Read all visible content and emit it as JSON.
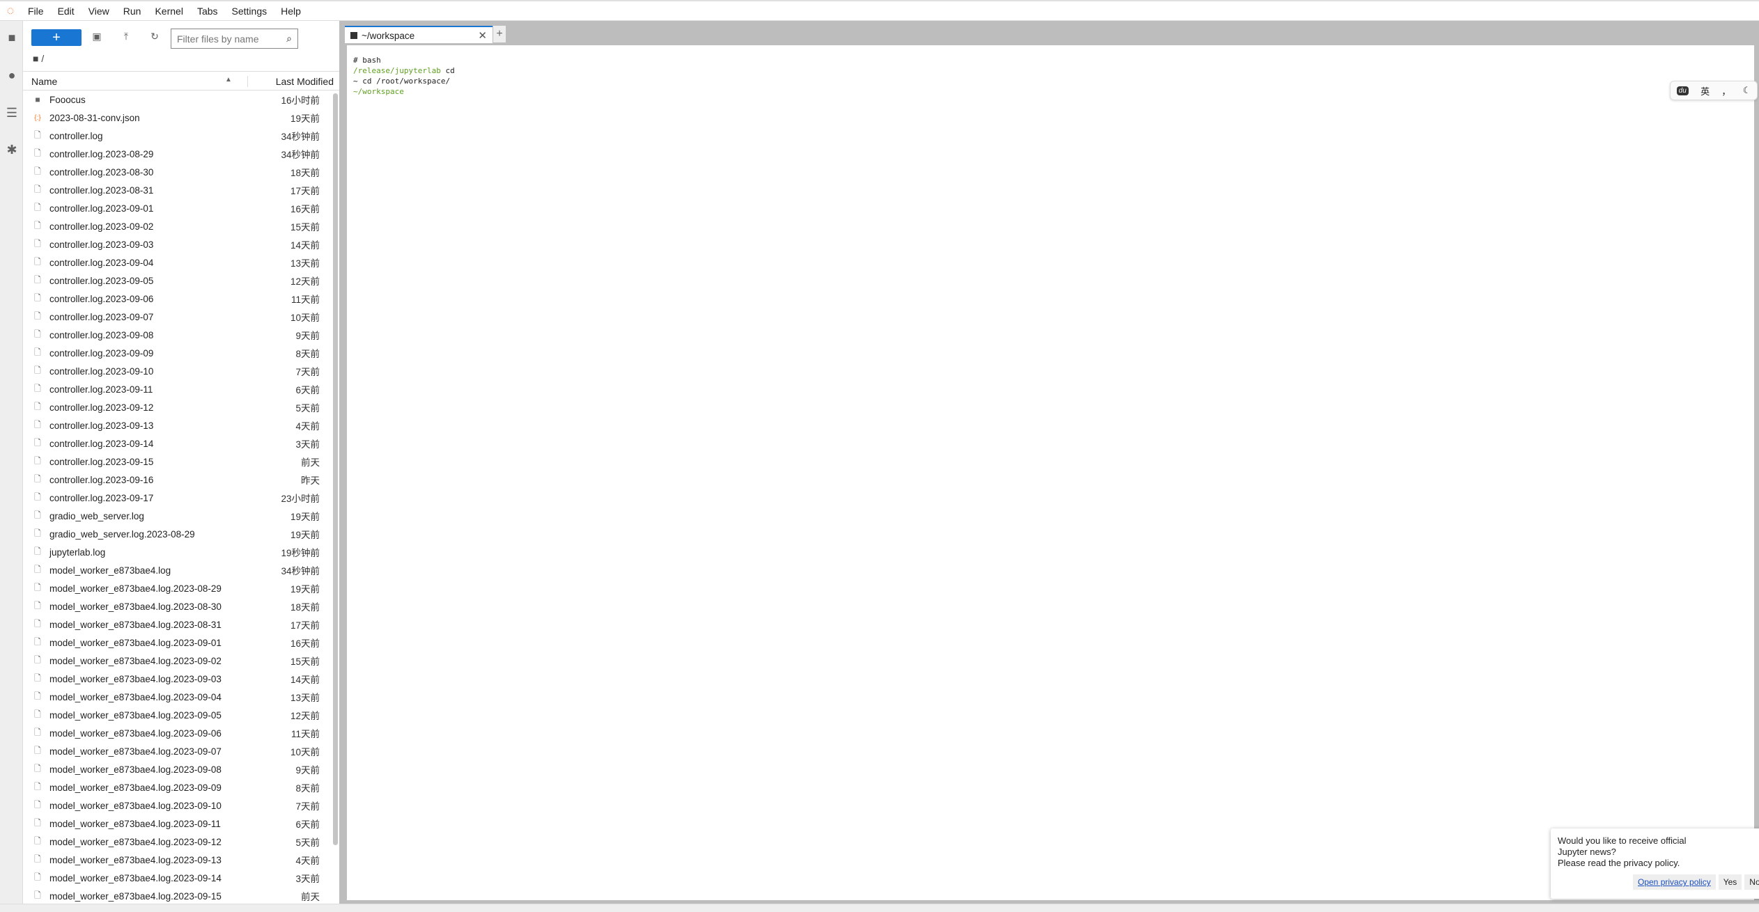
{
  "menu": [
    "File",
    "Edit",
    "View",
    "Run",
    "Kernel",
    "Tabs",
    "Settings",
    "Help"
  ],
  "filebrowser": {
    "new_label": "+",
    "filter_placeholder": "Filter files by name",
    "breadcrumb": "/",
    "col_name": "Name",
    "col_modified": "Last Modified",
    "files": [
      {
        "name": "Fooocus",
        "modified": "16小时前",
        "type": "folder"
      },
      {
        "name": "2023-08-31-conv.json",
        "modified": "19天前",
        "type": "json"
      },
      {
        "name": "controller.log",
        "modified": "34秒钟前",
        "type": "file"
      },
      {
        "name": "controller.log.2023-08-29",
        "modified": "34秒钟前",
        "type": "file"
      },
      {
        "name": "controller.log.2023-08-30",
        "modified": "18天前",
        "type": "file"
      },
      {
        "name": "controller.log.2023-08-31",
        "modified": "17天前",
        "type": "file"
      },
      {
        "name": "controller.log.2023-09-01",
        "modified": "16天前",
        "type": "file"
      },
      {
        "name": "controller.log.2023-09-02",
        "modified": "15天前",
        "type": "file"
      },
      {
        "name": "controller.log.2023-09-03",
        "modified": "14天前",
        "type": "file"
      },
      {
        "name": "controller.log.2023-09-04",
        "modified": "13天前",
        "type": "file"
      },
      {
        "name": "controller.log.2023-09-05",
        "modified": "12天前",
        "type": "file"
      },
      {
        "name": "controller.log.2023-09-06",
        "modified": "11天前",
        "type": "file"
      },
      {
        "name": "controller.log.2023-09-07",
        "modified": "10天前",
        "type": "file"
      },
      {
        "name": "controller.log.2023-09-08",
        "modified": "9天前",
        "type": "file"
      },
      {
        "name": "controller.log.2023-09-09",
        "modified": "8天前",
        "type": "file"
      },
      {
        "name": "controller.log.2023-09-10",
        "modified": "7天前",
        "type": "file"
      },
      {
        "name": "controller.log.2023-09-11",
        "modified": "6天前",
        "type": "file"
      },
      {
        "name": "controller.log.2023-09-12",
        "modified": "5天前",
        "type": "file"
      },
      {
        "name": "controller.log.2023-09-13",
        "modified": "4天前",
        "type": "file"
      },
      {
        "name": "controller.log.2023-09-14",
        "modified": "3天前",
        "type": "file"
      },
      {
        "name": "controller.log.2023-09-15",
        "modified": "前天",
        "type": "file"
      },
      {
        "name": "controller.log.2023-09-16",
        "modified": "昨天",
        "type": "file"
      },
      {
        "name": "controller.log.2023-09-17",
        "modified": "23小时前",
        "type": "file"
      },
      {
        "name": "gradio_web_server.log",
        "modified": "19天前",
        "type": "file"
      },
      {
        "name": "gradio_web_server.log.2023-08-29",
        "modified": "19天前",
        "type": "file"
      },
      {
        "name": "jupyterlab.log",
        "modified": "19秒钟前",
        "type": "file"
      },
      {
        "name": "model_worker_e873bae4.log",
        "modified": "34秒钟前",
        "type": "file"
      },
      {
        "name": "model_worker_e873bae4.log.2023-08-29",
        "modified": "19天前",
        "type": "file"
      },
      {
        "name": "model_worker_e873bae4.log.2023-08-30",
        "modified": "18天前",
        "type": "file"
      },
      {
        "name": "model_worker_e873bae4.log.2023-08-31",
        "modified": "17天前",
        "type": "file"
      },
      {
        "name": "model_worker_e873bae4.log.2023-09-01",
        "modified": "16天前",
        "type": "file"
      },
      {
        "name": "model_worker_e873bae4.log.2023-09-02",
        "modified": "15天前",
        "type": "file"
      },
      {
        "name": "model_worker_e873bae4.log.2023-09-03",
        "modified": "14天前",
        "type": "file"
      },
      {
        "name": "model_worker_e873bae4.log.2023-09-04",
        "modified": "13天前",
        "type": "file"
      },
      {
        "name": "model_worker_e873bae4.log.2023-09-05",
        "modified": "12天前",
        "type": "file"
      },
      {
        "name": "model_worker_e873bae4.log.2023-09-06",
        "modified": "11天前",
        "type": "file"
      },
      {
        "name": "model_worker_e873bae4.log.2023-09-07",
        "modified": "10天前",
        "type": "file"
      },
      {
        "name": "model_worker_e873bae4.log.2023-09-08",
        "modified": "9天前",
        "type": "file"
      },
      {
        "name": "model_worker_e873bae4.log.2023-09-09",
        "modified": "8天前",
        "type": "file"
      },
      {
        "name": "model_worker_e873bae4.log.2023-09-10",
        "modified": "7天前",
        "type": "file"
      },
      {
        "name": "model_worker_e873bae4.log.2023-09-11",
        "modified": "6天前",
        "type": "file"
      },
      {
        "name": "model_worker_e873bae4.log.2023-09-12",
        "modified": "5天前",
        "type": "file"
      },
      {
        "name": "model_worker_e873bae4.log.2023-09-13",
        "modified": "4天前",
        "type": "file"
      },
      {
        "name": "model_worker_e873bae4.log.2023-09-14",
        "modified": "3天前",
        "type": "file"
      },
      {
        "name": "model_worker_e873bae4.log.2023-09-15",
        "modified": "前天",
        "type": "file"
      }
    ]
  },
  "tab": {
    "label": "~/workspace",
    "add": "+",
    "close": "✕"
  },
  "terminal": {
    "line1": "# bash",
    "line2_path": "/release/jupyterlab",
    "line2_cmd": " cd",
    "line3": "~ cd /root/workspace/",
    "line4": "~/workspace"
  },
  "ime": {
    "logo": "du",
    "lang": "英",
    "punct": "，",
    "theme": "moon-icon"
  },
  "toast": {
    "message1": "Would you like to receive official Jupyter news?",
    "message2": "Please read the privacy policy.",
    "link": "Open privacy policy",
    "yes": "Yes",
    "no": "No",
    "close": "×"
  },
  "colors": {
    "accent": "#1976d2",
    "terminal_green": "#5fa021",
    "json_icon": "#f37726"
  }
}
